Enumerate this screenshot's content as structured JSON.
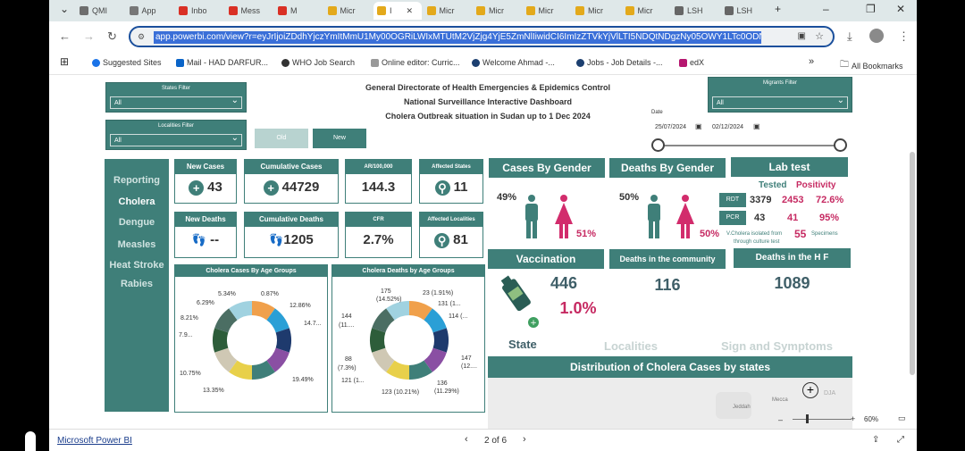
{
  "browser": {
    "tabs": [
      {
        "label": "QMI",
        "color": "#6e6e6e"
      },
      {
        "label": "App",
        "color": "#777"
      },
      {
        "label": "Inbo",
        "color": "#d93025"
      },
      {
        "label": "Mess",
        "color": "#d93025"
      },
      {
        "label": "M",
        "color": "#d93025"
      },
      {
        "label": "Micr",
        "color": "#e3a91b"
      },
      {
        "label": "I",
        "color": "#e3a91b"
      },
      {
        "label": "Micr",
        "color": "#e3a91b"
      },
      {
        "label": "Micr",
        "color": "#e3a91b"
      },
      {
        "label": "Micr",
        "color": "#e3a91b"
      },
      {
        "label": "Micr",
        "color": "#e3a91b"
      },
      {
        "label": "Micr",
        "color": "#e3a91b"
      },
      {
        "label": "LSH",
        "color": "#666"
      },
      {
        "label": "LSH",
        "color": "#666"
      }
    ],
    "url": "app.powerbi.com/view?r=eyJrIjoiZDdhYjczYmItMmU1My00OGRiLWIxMTUtM2VjZjg4YjE5ZmNlIiwidCI6ImIzZTVkYjVlLTI5NDQtNDgzNy05OWY1LTc0ODN",
    "bookmarks": [
      "Suggested Sites",
      "Mail - HAD DARFUR...",
      "WHO Job Search",
      "Online editor: Curric...",
      "Welcome Ahmad -...",
      "Jobs - Job Details -...",
      "edX"
    ],
    "all_bookmarks": "All Bookmarks",
    "controls": {
      "new_tab": "+",
      "minimize": "–",
      "maximize": "❐",
      "close": "✕",
      "back": "←",
      "forward": "→",
      "reload": "↻",
      "more": "»"
    }
  },
  "dashboard": {
    "title1": "General Directorate of Health Emergencies &  Epidemics Control",
    "title2": "National Surveillance Interactive Dashboard",
    "title3": "Cholera  Outbreak situation in Sudan up to 1 Dec  2024",
    "filters": {
      "states": {
        "title": "States Filter",
        "value": "All"
      },
      "localities": {
        "title": "Localities Filter",
        "value": "All"
      },
      "migrants": {
        "title": "Migrants Filter",
        "value": "All"
      }
    },
    "buttons": {
      "old": "Old",
      "new": "New"
    },
    "date": {
      "label": "Date",
      "from": "25/07/2024",
      "to": "02/12/2024"
    },
    "nav": [
      "Reporting",
      "Cholera",
      "Dengue",
      "Measles",
      "Heat Stroke",
      "Rabies"
    ],
    "kpis": {
      "new_cases": {
        "label": "New Cases",
        "value": "43"
      },
      "cumulative_cases": {
        "label": "Cumulative Cases",
        "value": "44729"
      },
      "ar": {
        "label": "AR/100,000",
        "value": "144.3"
      },
      "affected_states": {
        "label": "Affected States",
        "value": "11"
      },
      "new_deaths": {
        "label": "New Deaths",
        "value": "--"
      },
      "cumulative_deaths": {
        "label": "Cumulative Deaths",
        "value": "1205"
      },
      "cfr": {
        "label": "CFR",
        "value": "2.7%"
      },
      "affected_localities": {
        "label": "Affected Localities",
        "value": "81"
      }
    },
    "cases_by_gender": {
      "title": "Cases By Gender",
      "male": "49%",
      "female": "51%"
    },
    "deaths_by_gender": {
      "title": "Deaths By Gender",
      "male": "50%",
      "female": "50%"
    },
    "lab_test": {
      "title": "Lab test",
      "tested": "Tested",
      "positivity": "Positivity",
      "rdt": {
        "label": "RDT",
        "total": "3379",
        "tested": "2453",
        "pos": "72.6%"
      },
      "pcr": {
        "label": "PCR",
        "total": "43",
        "tested": "41",
        "pos": "95%"
      },
      "note": "V.Cholera isolated from",
      "note2": "through culture test",
      "count": "55",
      "unit": "Specimens"
    },
    "vaccination": {
      "title": "Vaccination",
      "value": "446",
      "pct": "1.0%"
    },
    "deaths_community": {
      "title": "Deaths in the community",
      "value": "116"
    },
    "deaths_hf": {
      "title": "Deaths in the H F",
      "value": "1089"
    },
    "tabs": [
      "State",
      "Localities",
      "Sign and Symptoms"
    ],
    "map": {
      "title": "Distribution of Cholera Cases by states",
      "label1": "Mecca",
      "label2": "Jeddah",
      "label3": "DJA"
    },
    "cases_by_age": {
      "title": "Cholera Cases By Age Groups",
      "labels": [
        "5.34%",
        "0.87%",
        "6.29%",
        "12.86%",
        "8.21%",
        "14.7...",
        "7.9...",
        "10.75%",
        "13.35%",
        "19.49%"
      ]
    },
    "deaths_by_age": {
      "title": "Cholera Deaths by Age Groups",
      "labels": [
        "175",
        "(14.52%)",
        "23 (1.91%)",
        "131 (1...",
        "114 (...",
        "144",
        "(11....",
        "88",
        "(7.3%)",
        "121 (1...",
        "123 (10.21%)",
        "136",
        "(11.29%)",
        "147",
        "(12...."
      ]
    }
  },
  "donut_colors": [
    "#f0a04b",
    "#2a9fd6",
    "#1e3a6d",
    "#8a4fa3",
    "#3f7f79",
    "#e8d04a",
    "#cfc8b4",
    "#2d5d3a",
    "#4b6e63",
    "#a0d2e0"
  ],
  "statusbar": {
    "brand": "Microsoft Power BI",
    "page": "2 of 6",
    "zoom": "60%"
  }
}
